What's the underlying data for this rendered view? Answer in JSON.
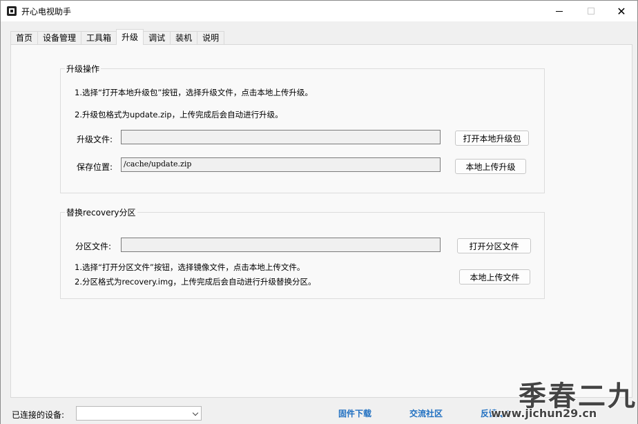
{
  "window": {
    "title": "开心电视助手"
  },
  "tabs": [
    {
      "label": "首页"
    },
    {
      "label": "设备管理"
    },
    {
      "label": "工具箱"
    },
    {
      "label": "升级",
      "active": true
    },
    {
      "label": "调试"
    },
    {
      "label": "装机"
    },
    {
      "label": "说明"
    }
  ],
  "upgrade_group": {
    "title": "升级操作",
    "instruction1": "1.选择“打开本地升级包”按钮，选择升级文件，点击本地上传升级。",
    "instruction2": "2.升级包格式为update.zip，上传完成后会自动进行升级。",
    "file_label": "升级文件:",
    "file_value": "",
    "save_label": "保存位置:",
    "save_value": "/cache/update.zip",
    "open_button": "打开本地升级包",
    "upload_button": "本地上传升级"
  },
  "recovery_group": {
    "title": "替换recovery分区",
    "file_label": "分区文件:",
    "file_value": "",
    "open_button": "打开分区文件",
    "upload_button": "本地上传文件",
    "instruction1": "1.选择“打开分区文件”按钮，选择镜像文件，点击本地上传文件。",
    "instruction2": "2.分区格式为recovery.img，上传完成后会自动进行升级替换分区。"
  },
  "status": {
    "device_label": "已连接的设备:",
    "device_value": "",
    "links": [
      "固件下载",
      "交流社区",
      "反馈QQ"
    ]
  },
  "watermark": {
    "big": "季春二九",
    "small": "www.jichun29.cn"
  },
  "colors": {
    "link": "#1f6fc1",
    "panel_bg": "#f9f9f9",
    "window_bg": "#f0f0f0"
  }
}
